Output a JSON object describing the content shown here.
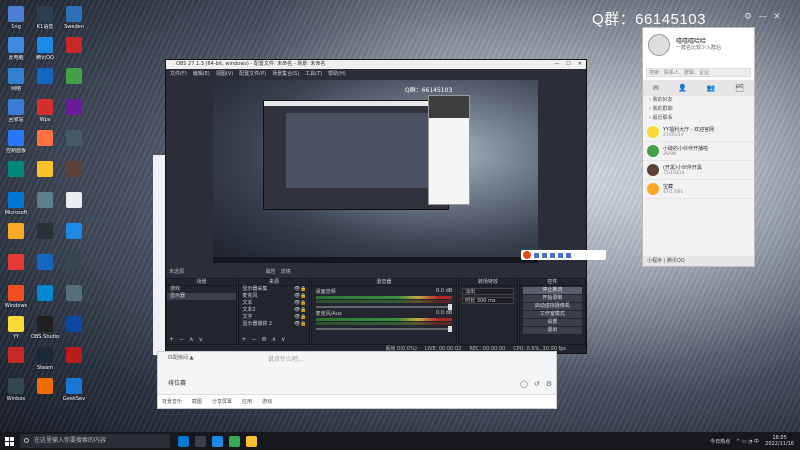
{
  "desktop": {
    "qq_group_label": "Q群：66145103",
    "icons": [
      {
        "label": "1ng",
        "color": "#4a7fd4"
      },
      {
        "label": "K1语音",
        "color": "#2c3e50"
      },
      {
        "label": "Sweden",
        "color": "#2e6fb5"
      },
      {
        "label": "此电脑",
        "color": "#3b8be0"
      },
      {
        "label": "腾讯QQ",
        "color": "#1e88e5"
      },
      {
        "label": "",
        "color": "#c62828"
      },
      {
        "label": "网络",
        "color": "#2f80d0"
      },
      {
        "label": "",
        "color": "#1565c0"
      },
      {
        "label": "",
        "color": "#43a047"
      },
      {
        "label": "回收站",
        "color": "#3a7bd5"
      },
      {
        "label": "Wps",
        "color": "#d32f2f"
      },
      {
        "label": "",
        "color": "#6a1b9a"
      },
      {
        "label": "控制面板",
        "color": "#2979ff"
      },
      {
        "label": "",
        "color": "#ff7043"
      },
      {
        "label": "",
        "color": "#455a64"
      },
      {
        "label": "",
        "color": "#00897b"
      },
      {
        "label": "",
        "color": "#fbc02d"
      },
      {
        "label": "",
        "color": "#5d4037"
      },
      {
        "label": "Microsoft",
        "color": "#0078d4"
      },
      {
        "label": "",
        "color": "#607d8b"
      },
      {
        "label": "",
        "color": "#eceff1"
      },
      {
        "label": "",
        "color": "#f9a825"
      },
      {
        "label": "",
        "color": "#263238"
      },
      {
        "label": "",
        "color": "#1e88e5"
      },
      {
        "label": "",
        "color": "#e53935"
      },
      {
        "label": "",
        "color": "#1565c0"
      },
      {
        "label": "",
        "color": "#37474f"
      },
      {
        "label": "Windows",
        "color": "#f25022"
      },
      {
        "label": "",
        "color": "#0288d1"
      },
      {
        "label": "",
        "color": "#546e7a"
      },
      {
        "label": "YY",
        "color": "#fdd835"
      },
      {
        "label": "OBS Studio",
        "color": "#212121"
      },
      {
        "label": "",
        "color": "#0d47a1"
      },
      {
        "label": "",
        "color": "#c62828"
      },
      {
        "label": "Steam",
        "color": "#1b2838"
      },
      {
        "label": "",
        "color": "#b71c1c"
      },
      {
        "label": "Winbox",
        "color": "#37474f"
      },
      {
        "label": "",
        "color": "#ef6c00"
      },
      {
        "label": "GeekSev",
        "color": "#1976d2"
      }
    ]
  },
  "obs": {
    "title": "OBS 27.1.3 (64-bit, windows) - 配置文件: 未命名 - 场景: 未命名",
    "menu": [
      "文件(F)",
      "编辑(E)",
      "视图(V)",
      "配置文件(P)",
      "场景集合(S)",
      "工具(T)",
      "帮助(H)"
    ],
    "inner_qq_group": "Q群：66145103",
    "source_bar": {
      "label": "未选源",
      "tools": [
        "属性",
        "滤镜"
      ]
    },
    "docks": {
      "scenes": {
        "header": "场景",
        "items": [
          "游戏",
          "显示器"
        ]
      },
      "sources": {
        "header": "来源",
        "items": [
          "显示器采集",
          "麦克风",
          "文本",
          "文本2",
          "文字",
          "显示器捕获 2"
        ]
      },
      "mixer": {
        "header": "混音器",
        "channels": [
          {
            "name": "桌面音频",
            "db": "0.0 dB"
          },
          {
            "name": "麦克风/Aux",
            "db": "0.0 dB"
          }
        ]
      },
      "transitions": {
        "header": "转场特效",
        "type": "淡出",
        "duration_label": "时长",
        "duration": "300 ms"
      },
      "controls": {
        "header": "控件",
        "buttons": [
          "停止推流",
          "开始录制",
          "启动虚拟摄像机",
          "工作室模式",
          "设置",
          "退出"
        ]
      }
    },
    "status": [
      "丢帧 0(0.0%)",
      "LIVE: 00:00:02",
      "REC: 00:00:00",
      "CPU: 0.6%, 30.00 fps"
    ]
  },
  "chat": {
    "input_placeholder": "说点什么吧...",
    "side_text": "匹配房间 ▲",
    "play_label": "排位赛",
    "tools": [
      "背景音乐",
      "截图",
      "分享屏幕",
      "应用",
      "游戏"
    ],
    "action_icons": [
      "◯",
      "↺",
      "⚙"
    ]
  },
  "qq": {
    "name": "嘻嘻嘻哈哈",
    "signature": "一群名比较少入群后",
    "search_placeholder": "搜索：联系人、群聊、企业",
    "tabs": [
      "✉",
      "👤",
      "👥",
      "🗂"
    ],
    "sections": [
      "我的好友",
      "我的群聊",
      "最近联系"
    ],
    "items": [
      {
        "name": "YY福利大厅 - 欢迎官网",
        "sub": "27/05/34",
        "color": "#fdd835"
      },
      {
        "name": "小破的小伙伴开播啦",
        "sub": "26/98",
        "color": "#43a047"
      },
      {
        "name": "(开黑)小伙伴开黑",
        "sub": "75/16434",
        "color": "#5d4037"
      },
      {
        "name": "宝藏",
        "sub": "47/17/61",
        "color": "#f9a825"
      }
    ],
    "footer": "小程序 | 腾讯QQ"
  },
  "taskbar": {
    "search_placeholder": "在这里输入你要搜索的内容",
    "apps": [
      {
        "color": "#0078d4"
      },
      {
        "color": "#3a3f4a"
      },
      {
        "color": "#1e88e5"
      },
      {
        "color": "#34a853"
      },
      {
        "color": "#fbc02d"
      }
    ],
    "tray_weather": "今日热点",
    "time": "18:05",
    "date": "2022/11/16"
  }
}
